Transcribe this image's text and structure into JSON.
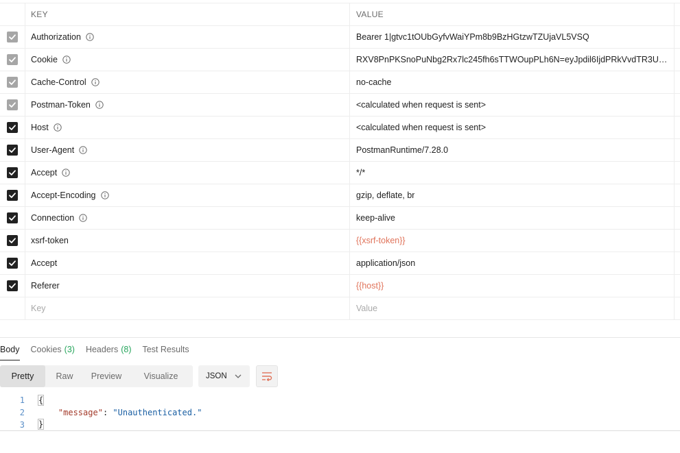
{
  "headers_table": {
    "columns": {
      "key": "KEY",
      "value": "VALUE"
    },
    "rows": [
      {
        "checked": "dim",
        "key": "Authorization",
        "info": true,
        "value": "Bearer 1|gtvc1tOUbGyfvWaiYPm8b9BzHGtzwTZUjaVL5VSQ",
        "is_variable": false
      },
      {
        "checked": "dim",
        "key": "Cookie",
        "info": true,
        "value": "RXV8PnPKSnoPuNbg2Rx7lc245fh6sTTWOupPLh6N=eyJpdil6IjdPRkVvdTR3UH...",
        "is_variable": false
      },
      {
        "checked": "dim",
        "key": "Cache-Control",
        "info": true,
        "value": "no-cache",
        "is_variable": false
      },
      {
        "checked": "dim",
        "key": "Postman-Token",
        "info": true,
        "value": "<calculated when request is sent>",
        "is_variable": false
      },
      {
        "checked": "on",
        "key": "Host",
        "info": true,
        "value": "<calculated when request is sent>",
        "is_variable": false
      },
      {
        "checked": "on",
        "key": "User-Agent",
        "info": true,
        "value": "PostmanRuntime/7.28.0",
        "is_variable": false
      },
      {
        "checked": "on",
        "key": "Accept",
        "info": true,
        "value": "*/*",
        "is_variable": false
      },
      {
        "checked": "on",
        "key": "Accept-Encoding",
        "info": true,
        "value": "gzip, deflate, br",
        "is_variable": false
      },
      {
        "checked": "on",
        "key": "Connection",
        "info": true,
        "value": "keep-alive",
        "is_variable": false
      },
      {
        "checked": "on",
        "key": "xsrf-token",
        "info": false,
        "value": "{{xsrf-token}}",
        "is_variable": true
      },
      {
        "checked": "on",
        "key": "Accept",
        "info": false,
        "value": "application/json",
        "is_variable": false
      },
      {
        "checked": "on",
        "key": "Referer",
        "info": false,
        "value": "{{host}}",
        "is_variable": true
      }
    ],
    "new_row": {
      "key_placeholder": "Key",
      "value_placeholder": "Value"
    }
  },
  "response": {
    "tabs": [
      {
        "label": "Body",
        "count": "",
        "active": true
      },
      {
        "label": "Cookies",
        "count": "(3)",
        "active": false
      },
      {
        "label": "Headers",
        "count": "(8)",
        "active": false
      },
      {
        "label": "Test Results",
        "count": "",
        "active": false
      }
    ],
    "view_modes": [
      "Pretty",
      "Raw",
      "Preview",
      "Visualize"
    ],
    "active_view": "Pretty",
    "format": "JSON",
    "code_lines": [
      {
        "num": "1",
        "text": "{"
      },
      {
        "num": "2",
        "key": "\"message\"",
        "sep": ": ",
        "str": "\"Unauthenticated.\""
      },
      {
        "num": "3",
        "text": "}"
      }
    ]
  },
  "colors": {
    "variable": "#e0735a",
    "count_badge": "#26a55c",
    "json_key": "#a33a2a",
    "json_string": "#1a5fa3",
    "line_number": "#5a8fc8"
  }
}
